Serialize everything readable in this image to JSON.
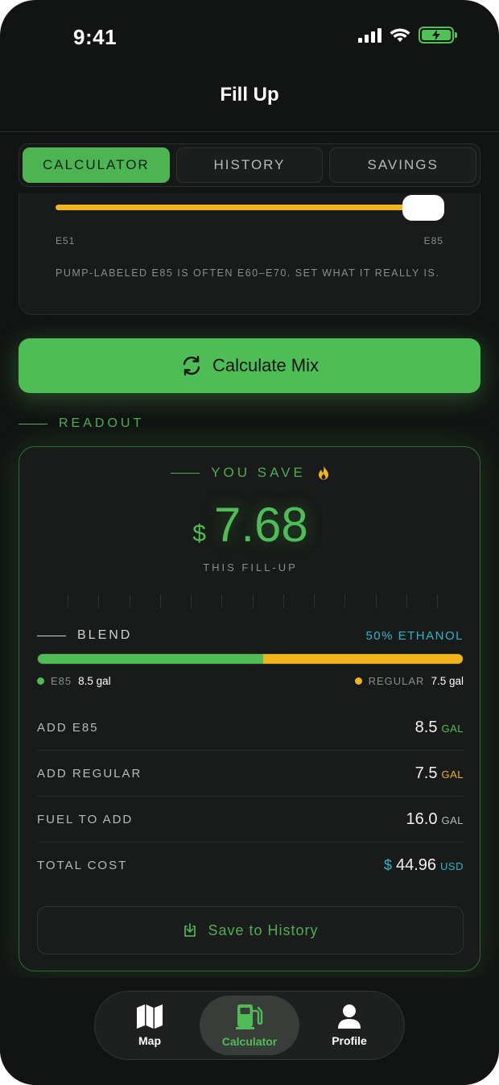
{
  "status": {
    "time": "9:41"
  },
  "header": {
    "title": "Fill Up"
  },
  "tabs": [
    {
      "label": "CALCULATOR",
      "active": true
    },
    {
      "label": "HISTORY",
      "active": false
    },
    {
      "label": "SAVINGS",
      "active": false
    }
  ],
  "slider": {
    "min_label": "E51",
    "max_label": "E85",
    "value_fraction": 1.0,
    "note": "PUMP-LABELED E85 IS OFTEN E60–E70. SET WHAT IT REALLY IS."
  },
  "calculate_button": {
    "label": "Calculate Mix",
    "icon": "refresh-icon"
  },
  "readout": {
    "section_label": "READOUT",
    "you_save": "YOU SAVE",
    "currency": "$",
    "savings": "7.68",
    "fill_label": "THIS FILL-UP",
    "blend": {
      "label": "BLEND",
      "ethanol_pct": "50% ETHANOL",
      "e85_fraction": 0.53,
      "e85_label": "E85",
      "e85_gal": "8.5 gal",
      "regular_label": "REGULAR",
      "regular_gal": "7.5 gal"
    },
    "rows": [
      {
        "label": "ADD E85",
        "prefix": "",
        "value": "8.5",
        "unit": "GAL",
        "unit_color": "#4fbd55"
      },
      {
        "label": "ADD REGULAR",
        "prefix": "",
        "value": "7.5",
        "unit": "GAL",
        "unit_color": "#f1b41c"
      },
      {
        "label": "FUEL TO ADD",
        "prefix": "",
        "value": "16.0",
        "unit": "GAL",
        "unit_color": "#b7bbb8"
      },
      {
        "label": "TOTAL COST",
        "prefix": "$",
        "value": "44.96",
        "unit": "USD",
        "unit_color": "#2fb3c9"
      }
    ],
    "save_button": "Save to History"
  },
  "nav": [
    {
      "label": "Map",
      "icon": "map-icon",
      "active": false
    },
    {
      "label": "Calculator",
      "icon": "fuel-pump-icon",
      "active": true
    },
    {
      "label": "Profile",
      "icon": "person-icon",
      "active": false
    }
  ],
  "colors": {
    "accent": "#4fbd55",
    "regular": "#f1b41c",
    "cyan": "#2fb3c9"
  }
}
